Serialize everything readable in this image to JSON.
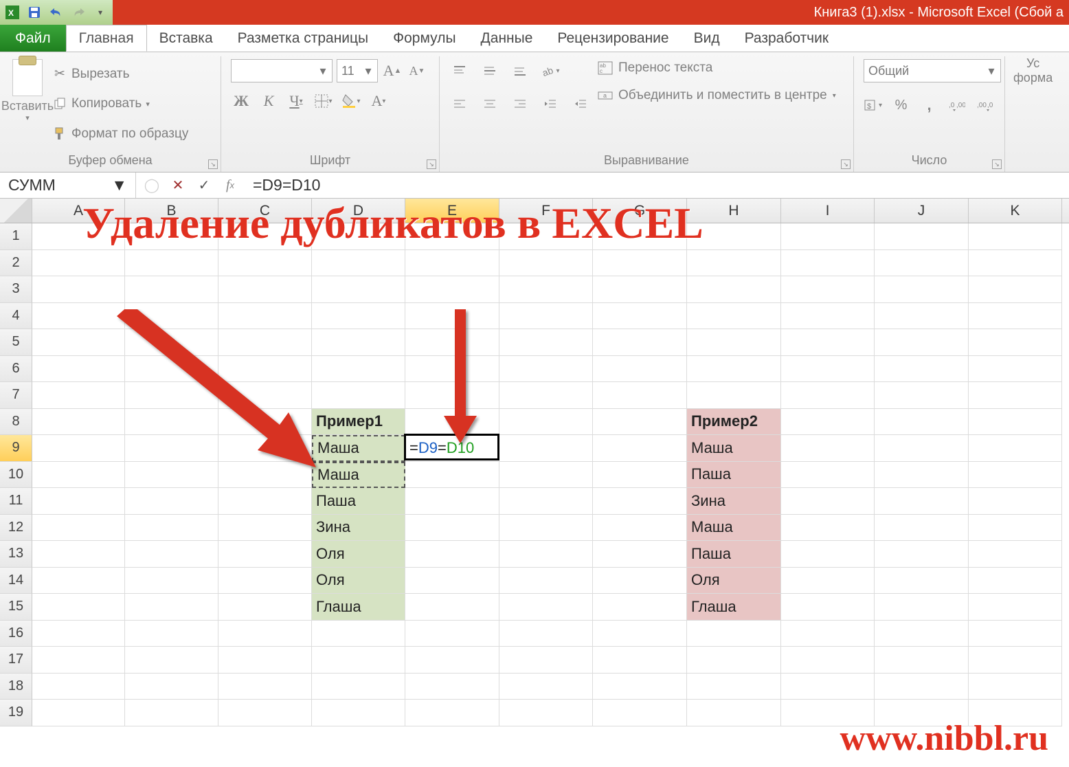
{
  "title": "Книга3 (1).xlsx - Microsoft Excel (Сбой а",
  "tabs": {
    "file": "Файл",
    "home": "Главная",
    "insert": "Вставка",
    "layout": "Разметка страницы",
    "formulas": "Формулы",
    "data": "Данные",
    "review": "Рецензирование",
    "view": "Вид",
    "developer": "Разработчик"
  },
  "ribbon": {
    "clipboard": {
      "label": "Буфер обмена",
      "paste": "Вставить",
      "cut": "Вырезать",
      "copy": "Копировать",
      "format_painter": "Формат по образцу"
    },
    "font": {
      "label": "Шрифт",
      "size": "11"
    },
    "alignment": {
      "label": "Выравнивание",
      "wrap": "Перенос текста",
      "merge": "Объединить и поместить в центре"
    },
    "number": {
      "label": "Число",
      "format": "Общий"
    },
    "cond": {
      "line1": "Ус",
      "line2": "форма"
    }
  },
  "namebox": "СУММ",
  "formula": "=D9=D10",
  "cols": [
    "A",
    "B",
    "C",
    "D",
    "E",
    "F",
    "G",
    "H",
    "I",
    "J",
    "K"
  ],
  "col_widths": {
    "A": 135,
    "B": 136,
    "C": 136,
    "D": 136,
    "E": 137,
    "F": 136,
    "G": 137,
    "H": 137,
    "I": 136,
    "J": 137,
    "K": 136
  },
  "active_col": "E",
  "active_row": 9,
  "row_count": 19,
  "cells": {
    "D8": "Пример1",
    "D9": "Маша",
    "D10": "Маша",
    "D11": "Паша",
    "D12": "Зина",
    "D13": "Оля",
    "D14": "Оля",
    "D15": "Глаша",
    "H8": "Пример2",
    "H9": "Маша",
    "H10": "Паша",
    "H11": "Зина",
    "H12": "Маша",
    "H13": "Паша",
    "H14": "Оля",
    "H15": "Глаша"
  },
  "editing_cell": {
    "prefix": "=",
    "ref1": "D9",
    "mid": "=",
    "ref2": "D10"
  },
  "overlay_title": "Удаление дубликатов в EXCEL",
  "watermark": "www.nibbl.ru"
}
